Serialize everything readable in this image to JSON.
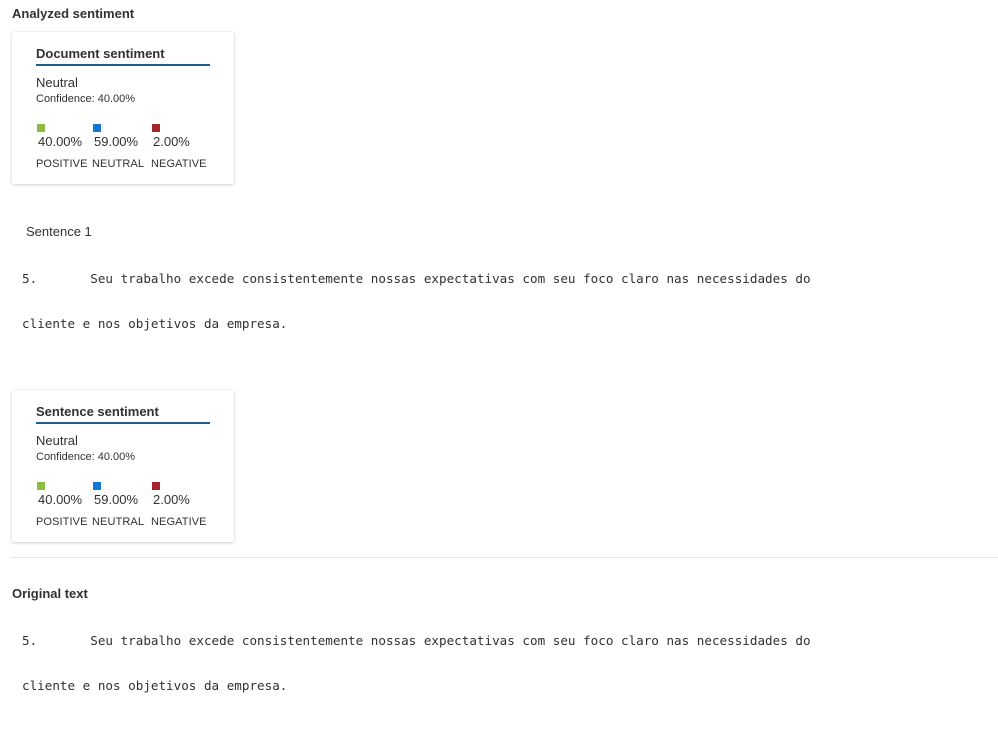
{
  "analyzed_title": "Analyzed sentiment",
  "document_card": {
    "title": "Document sentiment",
    "label": "Neutral",
    "confidence": "Confidence: 40.00%",
    "positive_value": "40.00%",
    "neutral_value": "59.00%",
    "negative_value": "2.00%",
    "positive_label": "POSITIVE",
    "neutral_label": "NEUTRAL",
    "negative_label": "NEGATIVE"
  },
  "sentence": {
    "label": "Sentence 1",
    "line1": "5.       Seu trabalho excede consistentemente nossas expectativas com seu foco claro nas necessidades do",
    "line2": "cliente e nos objetivos da empresa."
  },
  "sentence_card": {
    "title": "Sentence sentiment",
    "label": "Neutral",
    "confidence": "Confidence: 40.00%",
    "positive_value": "40.00%",
    "neutral_value": "59.00%",
    "negative_value": "2.00%",
    "positive_label": "POSITIVE",
    "neutral_label": "NEUTRAL",
    "negative_label": "NEGATIVE"
  },
  "original_title": "Original text",
  "original": {
    "line1": "5.       Seu trabalho excede consistentemente nossas expectativas com seu foco claro nas necessidades do",
    "line2": "cliente e nos objetivos da empresa."
  },
  "colors": {
    "positive": "#8cbd3f",
    "neutral": "#0f78d4",
    "negative": "#a4262c"
  }
}
